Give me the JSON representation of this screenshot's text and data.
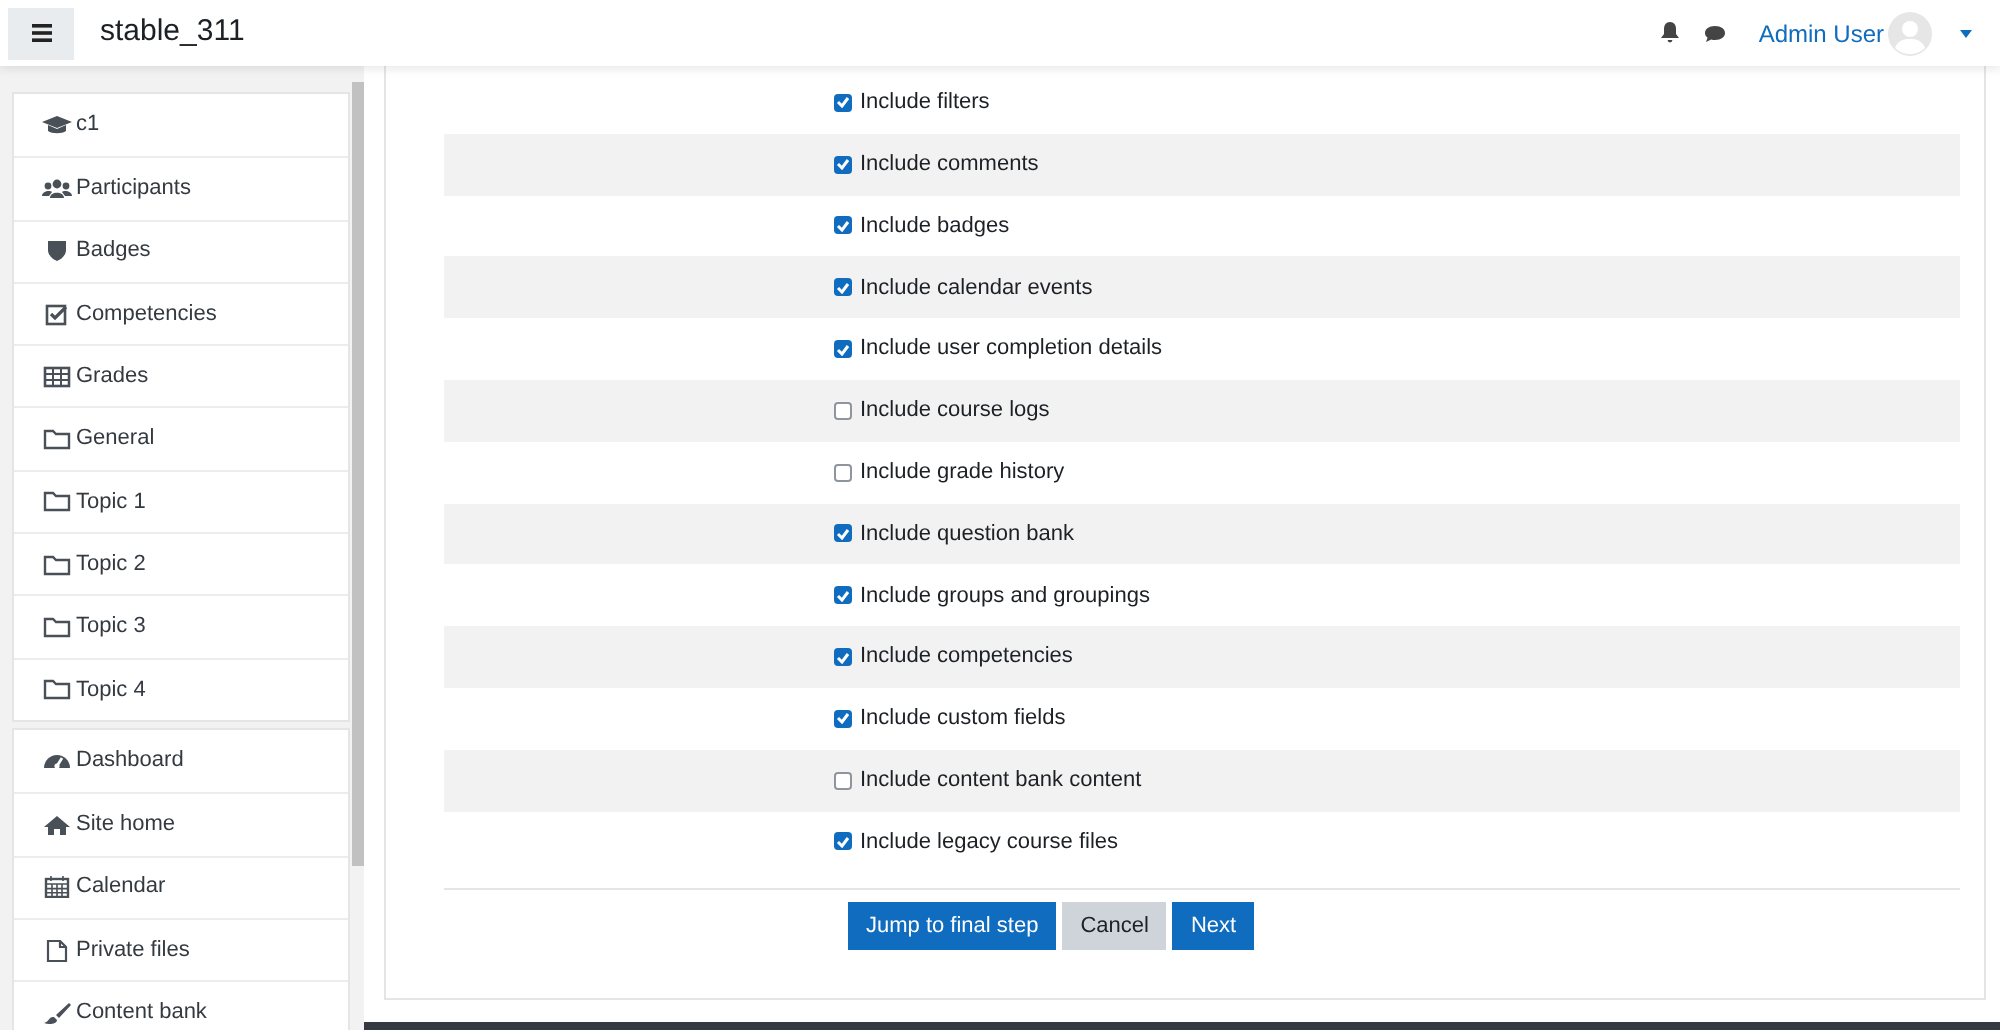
{
  "navbar": {
    "title": "stable_311",
    "user": "Admin User"
  },
  "sidebar": {
    "groups": [
      {
        "items": [
          {
            "label": "c1",
            "kind": "course"
          },
          {
            "label": "Participants",
            "kind": "participants"
          },
          {
            "label": "Badges",
            "kind": "badges"
          },
          {
            "label": "Competencies",
            "kind": "competencies"
          },
          {
            "label": "Grades",
            "kind": "grades"
          },
          {
            "label": "General",
            "kind": "section"
          },
          {
            "label": "Topic 1",
            "kind": "section"
          },
          {
            "label": "Topic 2",
            "kind": "section"
          },
          {
            "label": "Topic 3",
            "kind": "section"
          },
          {
            "label": "Topic 4",
            "kind": "section"
          }
        ]
      },
      {
        "items": [
          {
            "label": "Dashboard",
            "kind": "dashboard"
          },
          {
            "label": "Site home",
            "kind": "home"
          },
          {
            "label": "Calendar",
            "kind": "calendar"
          },
          {
            "label": "Private files",
            "kind": "files"
          },
          {
            "label": "Content bank",
            "kind": "contentbank"
          }
        ]
      }
    ]
  },
  "settings": [
    {
      "label": "Include filters",
      "checked": true
    },
    {
      "label": "Include comments",
      "checked": true
    },
    {
      "label": "Include badges",
      "checked": true
    },
    {
      "label": "Include calendar events",
      "checked": true
    },
    {
      "label": "Include user completion details",
      "checked": true
    },
    {
      "label": "Include course logs",
      "checked": false
    },
    {
      "label": "Include grade history",
      "checked": false
    },
    {
      "label": "Include question bank",
      "checked": true
    },
    {
      "label": "Include groups and groupings",
      "checked": true
    },
    {
      "label": "Include competencies",
      "checked": true
    },
    {
      "label": "Include custom fields",
      "checked": true
    },
    {
      "label": "Include content bank content",
      "checked": false
    },
    {
      "label": "Include legacy course files",
      "checked": true
    }
  ],
  "buttons": [
    {
      "label": "Jump to final step",
      "kind": "primary"
    },
    {
      "label": "Cancel",
      "kind": "secondary"
    },
    {
      "label": "Next",
      "kind": "primary"
    }
  ]
}
